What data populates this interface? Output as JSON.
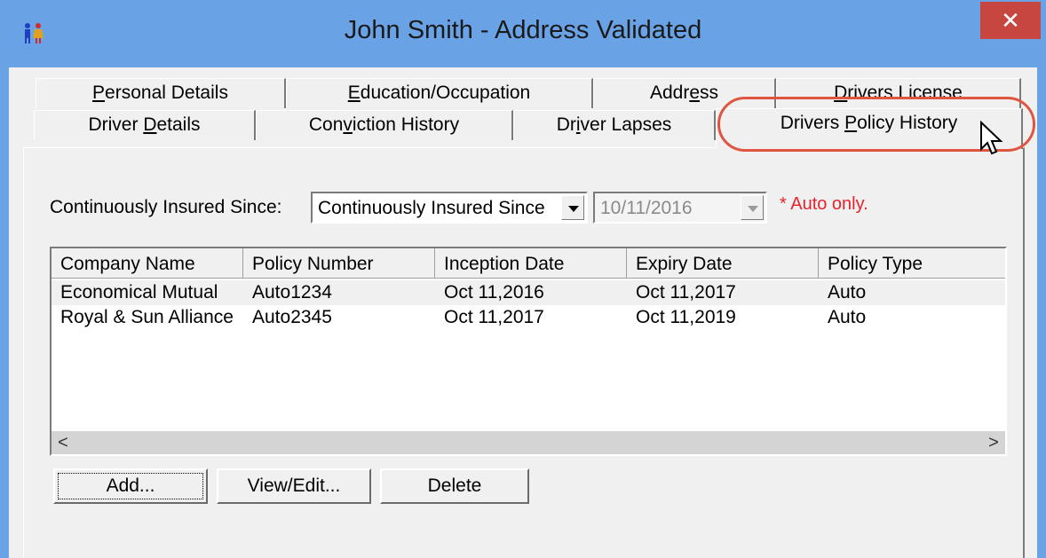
{
  "window": {
    "title": "John Smith - Address Validated",
    "close_label": "✕",
    "accent_color": "#6aa2e6",
    "close_color": "#c7463f"
  },
  "tabs": {
    "back_row": [
      {
        "label": "Personal Details",
        "underline_index": 0
      },
      {
        "label": "Education/Occupation",
        "underline_index": 0
      },
      {
        "label": "Address",
        "underline_index": 4
      },
      {
        "label": "Drivers License",
        "underline_index": 0
      }
    ],
    "front_row": [
      {
        "label": "Driver Details",
        "underline_index": 7
      },
      {
        "label": "Conviction History",
        "underline_index": 3
      },
      {
        "label": "Driver Lapses",
        "underline_index": 2
      },
      {
        "label": "Drivers Policy History",
        "underline_index": 8
      }
    ],
    "active": "Drivers Policy History"
  },
  "insured": {
    "label": "Continuously Insured Since:",
    "select_value": "Continuously Insured Since",
    "date_value": "10/11/2016",
    "note": "* Auto only.",
    "note_color": "#e8222b"
  },
  "table": {
    "columns": [
      "Company Name",
      "Policy Number",
      "Inception Date",
      "Expiry Date",
      "Policy Type"
    ],
    "rows": [
      {
        "company": "Economical Mutual",
        "policy": "Auto1234",
        "inception": "Oct 11,2016",
        "expiry": "Oct 11,2017",
        "type": "Auto"
      },
      {
        "company": "Royal & Sun Alliance",
        "policy": "Auto2345",
        "inception": "Oct 11,2017",
        "expiry": "Oct 11,2019",
        "type": "Auto"
      }
    ],
    "scroll_left": "<",
    "scroll_right": ">"
  },
  "buttons": {
    "add": "Add...",
    "view_edit": "View/Edit...",
    "delete": "Delete"
  },
  "highlight_color": "#e05540"
}
